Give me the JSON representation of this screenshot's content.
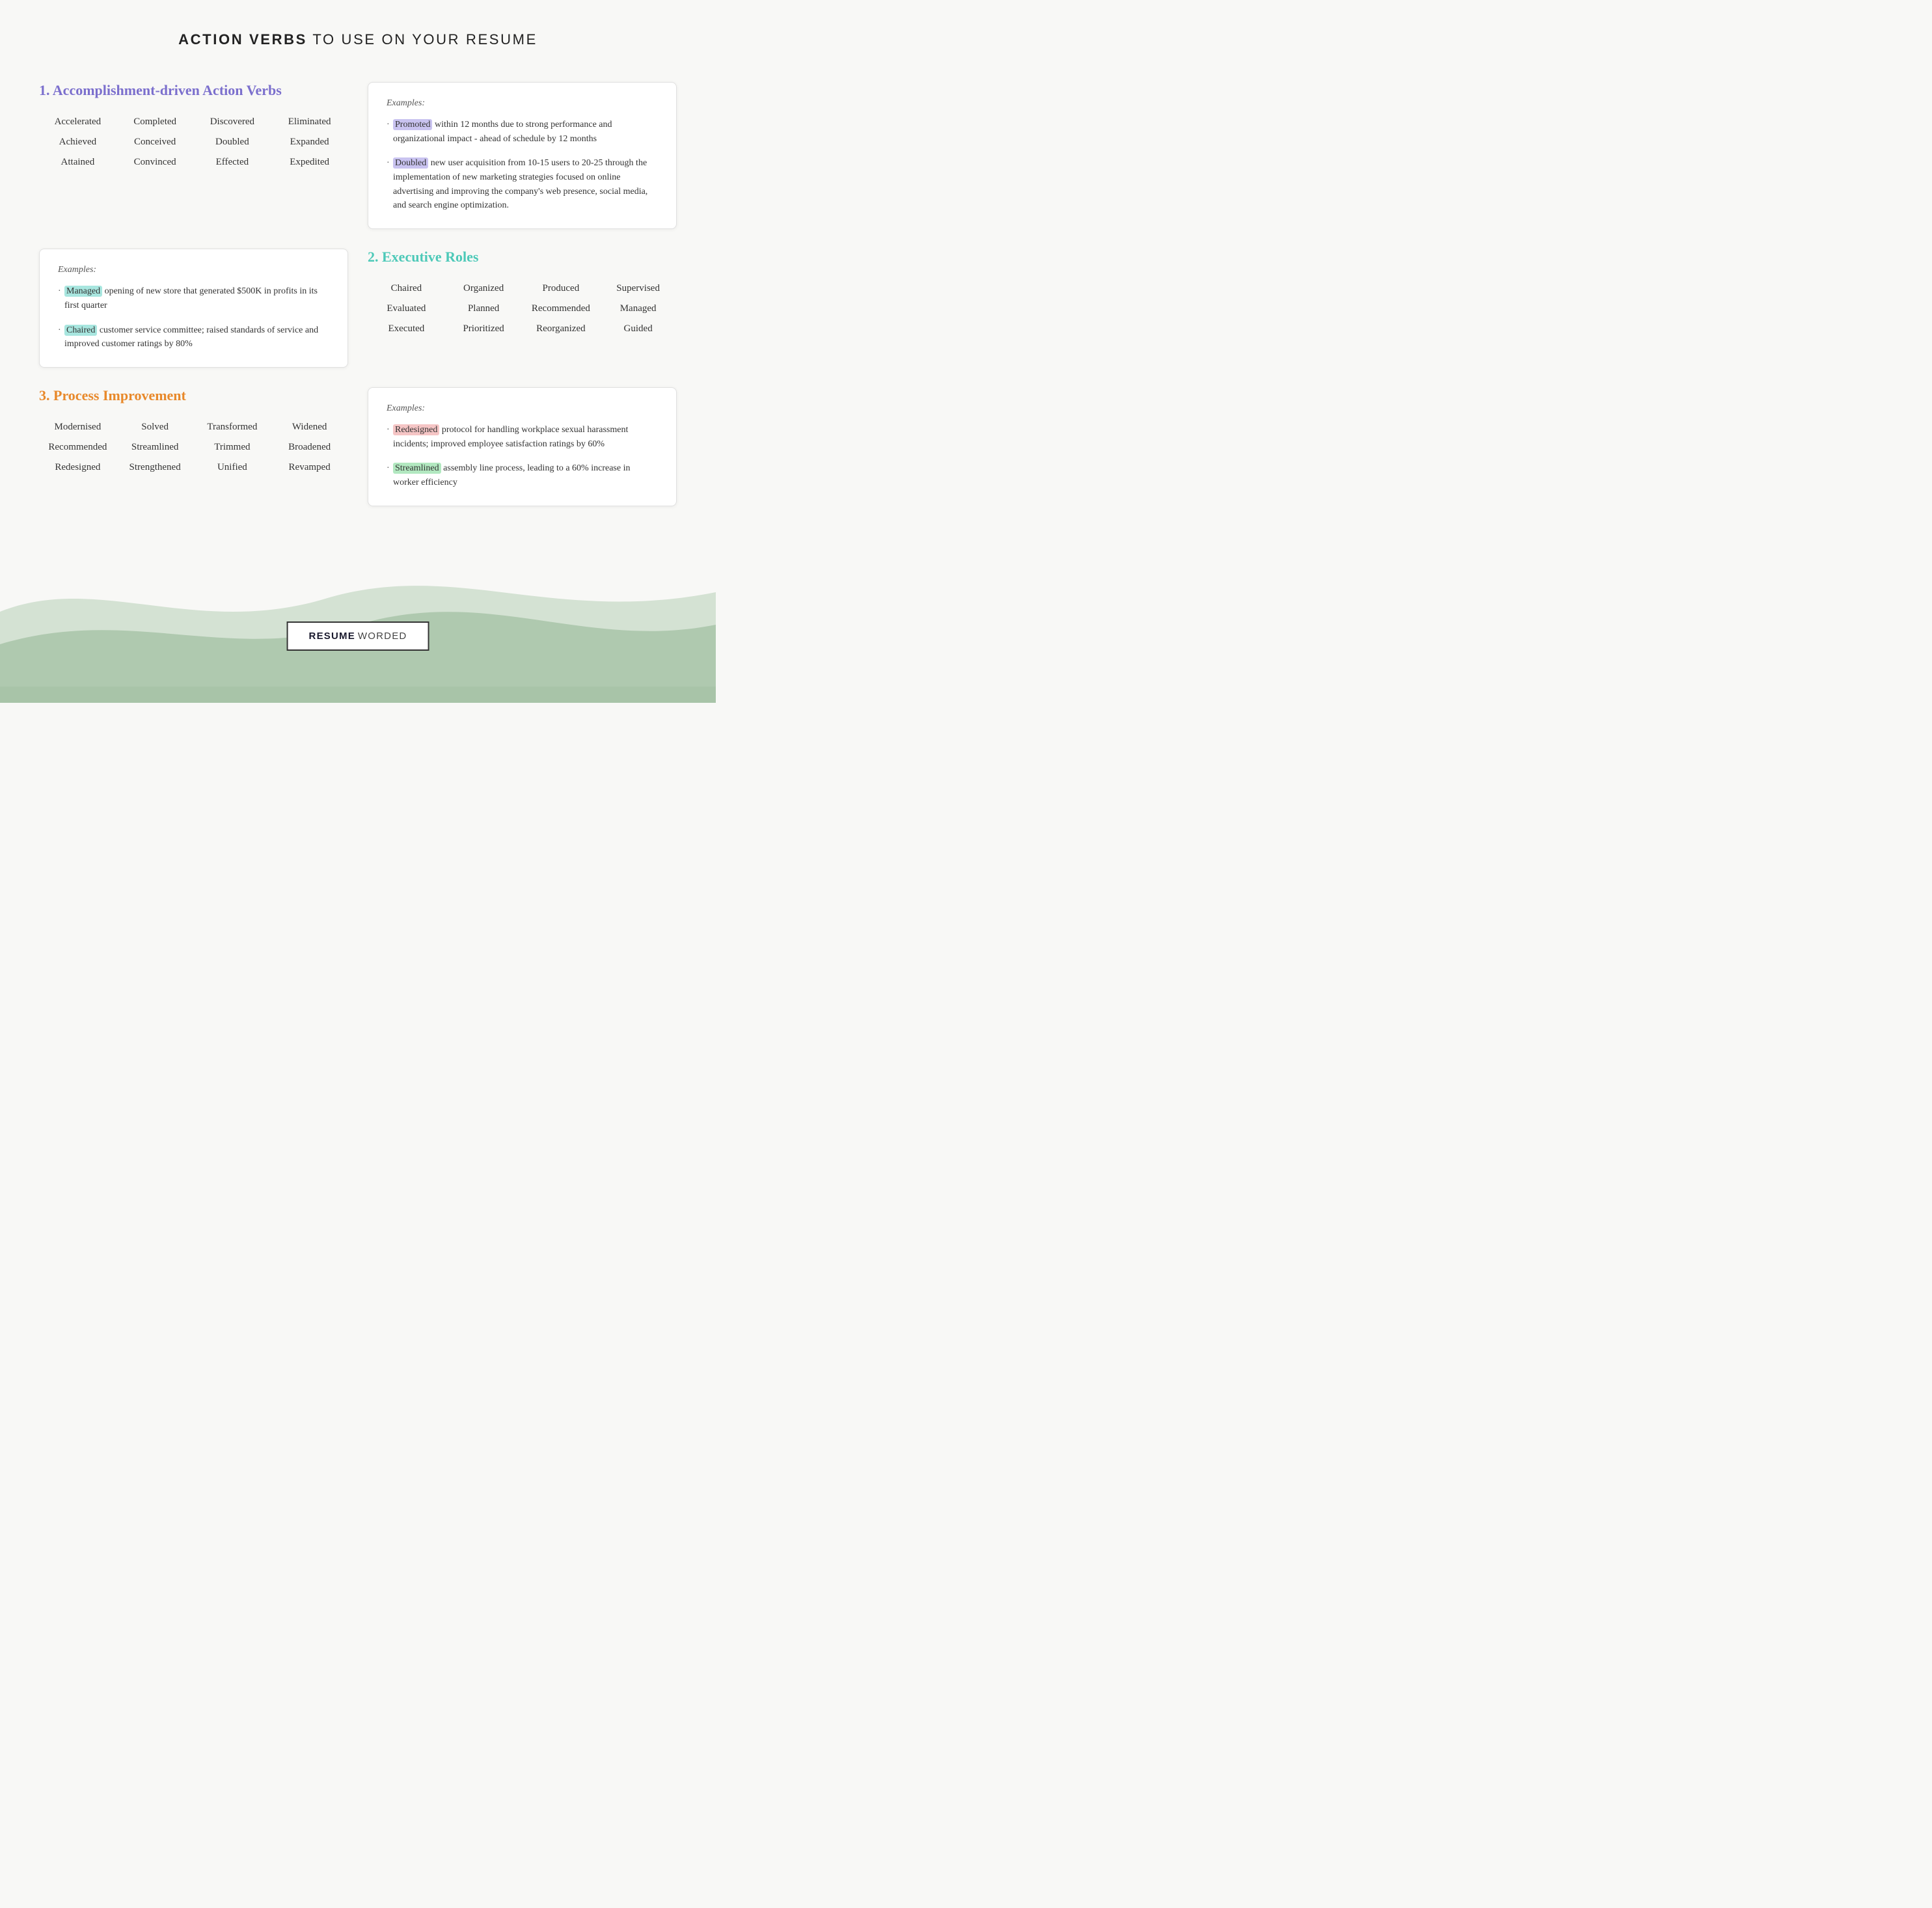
{
  "header": {
    "bold_part": "ACTION VERBS",
    "rest_part": " TO USE ON YOUR RESUME"
  },
  "section1": {
    "title": "1. Accomplishment-driven Action Verbs",
    "color": "purple",
    "verbs": [
      [
        "Accelerated",
        "Completed",
        "Discovered",
        "Eliminated"
      ],
      [
        "Achieved",
        "Conceived",
        "Doubled",
        "Expanded"
      ],
      [
        "Attained",
        "Convinced",
        "Effected",
        "Expedited"
      ]
    ],
    "examples_label": "Examples:",
    "examples": [
      {
        "highlight": "Promoted",
        "highlight_class": "highlight-purple",
        "text": " within 12 months due to strong performance and organizational impact - ahead of schedule by 12 months"
      },
      {
        "highlight": "Doubled",
        "highlight_class": "highlight-purple",
        "text": " new user acquisition from 10-15 users to 20-25 through the implementation of new marketing strategies focused on online advertising and improving the company's web presence, social media, and search engine optimization."
      }
    ]
  },
  "section1_left_example": {
    "examples_label": "Examples:",
    "examples": [
      {
        "highlight": "Managed",
        "highlight_class": "highlight-teal",
        "text": " opening of new store that generated $500K in profits in its first quarter"
      },
      {
        "highlight": "Chaired",
        "highlight_class": "highlight-teal",
        "text": " customer service committee; raised standards of service and improved customer ratings by 80%"
      }
    ]
  },
  "section2": {
    "title": "2. Executive Roles",
    "color": "teal",
    "verbs": [
      [
        "Chaired",
        "Organized",
        "Produced",
        "Supervised"
      ],
      [
        "Evaluated",
        "Planned",
        "Recommended",
        "Managed"
      ],
      [
        "Executed",
        "Prioritized",
        "Reorganized",
        "Guided"
      ]
    ]
  },
  "section3": {
    "title": "3. Process Improvement",
    "color": "orange",
    "verbs": [
      [
        "Modernised",
        "Solved",
        "Transformed",
        "Widened"
      ],
      [
        "Recommended",
        "Streamlined",
        "Trimmed",
        "Broadened"
      ],
      [
        "Redesigned",
        "Strengthened",
        "Unified",
        "Revamped"
      ]
    ],
    "examples_label": "Examples:",
    "examples": [
      {
        "highlight": "Redesigned",
        "highlight_class": "highlight-pink",
        "text": " protocol for handling workplace sexual harassment incidents; improved employee satisfaction ratings by 60%"
      },
      {
        "highlight": "Streamlined",
        "highlight_class": "highlight-green",
        "text": " assembly line process, leading to a 60% increase in worker efficiency"
      }
    ]
  },
  "footer": {
    "bold": "RESUME",
    "light": " WORDED"
  }
}
